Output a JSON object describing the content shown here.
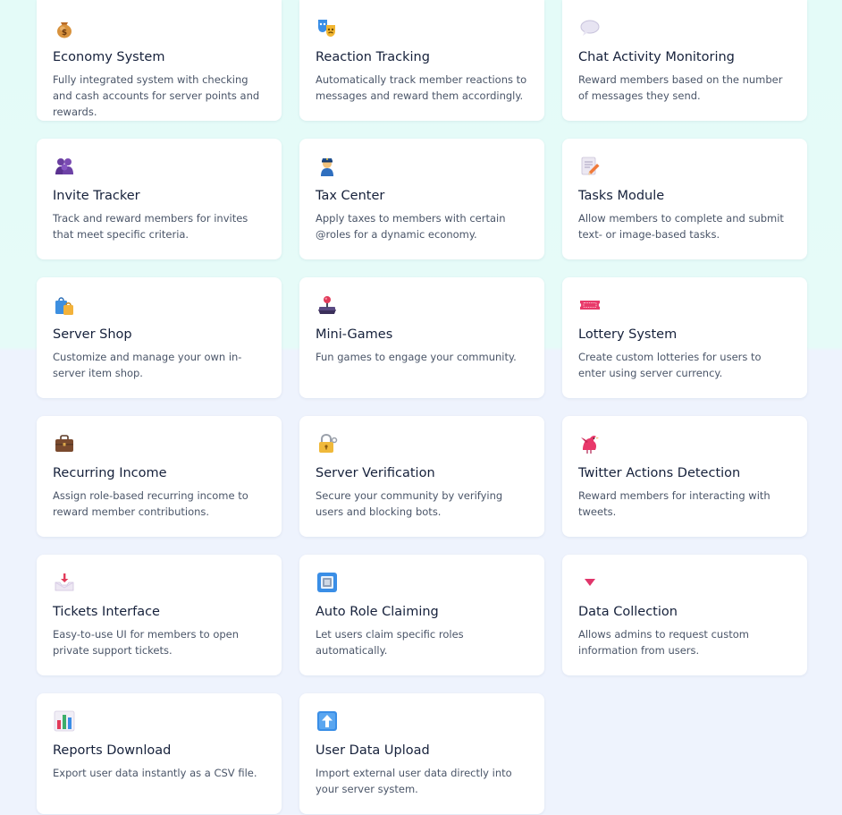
{
  "features": [
    {
      "title": "Economy System",
      "desc": "Fully integrated system with checking and cash accounts for server points and rewards.",
      "icon": "money-bag-icon"
    },
    {
      "title": "Reaction Tracking",
      "desc": "Automatically track member reactions to messages and reward them accordingly.",
      "icon": "theater-masks-icon"
    },
    {
      "title": "Chat Activity Monitoring",
      "desc": "Reward members based on the number of messages they send.",
      "icon": "speech-bubble-icon"
    },
    {
      "title": "Invite Tracker",
      "desc": "Track and reward members for invites that meet specific criteria.",
      "icon": "people-group-icon"
    },
    {
      "title": "Tax Center",
      "desc": "Apply taxes to members with certain @roles for a dynamic economy.",
      "icon": "police-officer-icon"
    },
    {
      "title": "Tasks Module",
      "desc": "Allow members to complete and submit text- or image-based tasks.",
      "icon": "memo-pencil-icon"
    },
    {
      "title": "Server Shop",
      "desc": "Customize and manage your own in-server item shop.",
      "icon": "shopping-bags-icon"
    },
    {
      "title": "Mini-Games",
      "desc": "Fun games to engage your community.",
      "icon": "joystick-icon"
    },
    {
      "title": "Lottery System",
      "desc": "Create custom lotteries for users to enter using server currency.",
      "icon": "ticket-icon"
    },
    {
      "title": "Recurring Income",
      "desc": "Assign role-based recurring income to reward member contributions.",
      "icon": "briefcase-icon"
    },
    {
      "title": "Server Verification",
      "desc": "Secure your community by verifying users and blocking bots.",
      "icon": "lock-key-icon"
    },
    {
      "title": "Twitter Actions Detection",
      "desc": "Reward members for interacting with tweets.",
      "icon": "bird-icon"
    },
    {
      "title": "Tickets Interface",
      "desc": "Easy-to-use UI for members to open private support tickets.",
      "icon": "inbox-tray-icon"
    },
    {
      "title": "Auto Role Claiming",
      "desc": "Let users claim specific roles automatically.",
      "icon": "id-card-icon"
    },
    {
      "title": "Data Collection",
      "desc": "Allows admins to request custom information from users.",
      "icon": "red-triangle-down-icon"
    },
    {
      "title": "Reports Download",
      "desc": "Export user data instantly as a CSV file.",
      "icon": "bar-chart-icon"
    },
    {
      "title": "User Data Upload",
      "desc": "Import external user data directly into your server system.",
      "icon": "up-arrow-button-icon"
    }
  ]
}
